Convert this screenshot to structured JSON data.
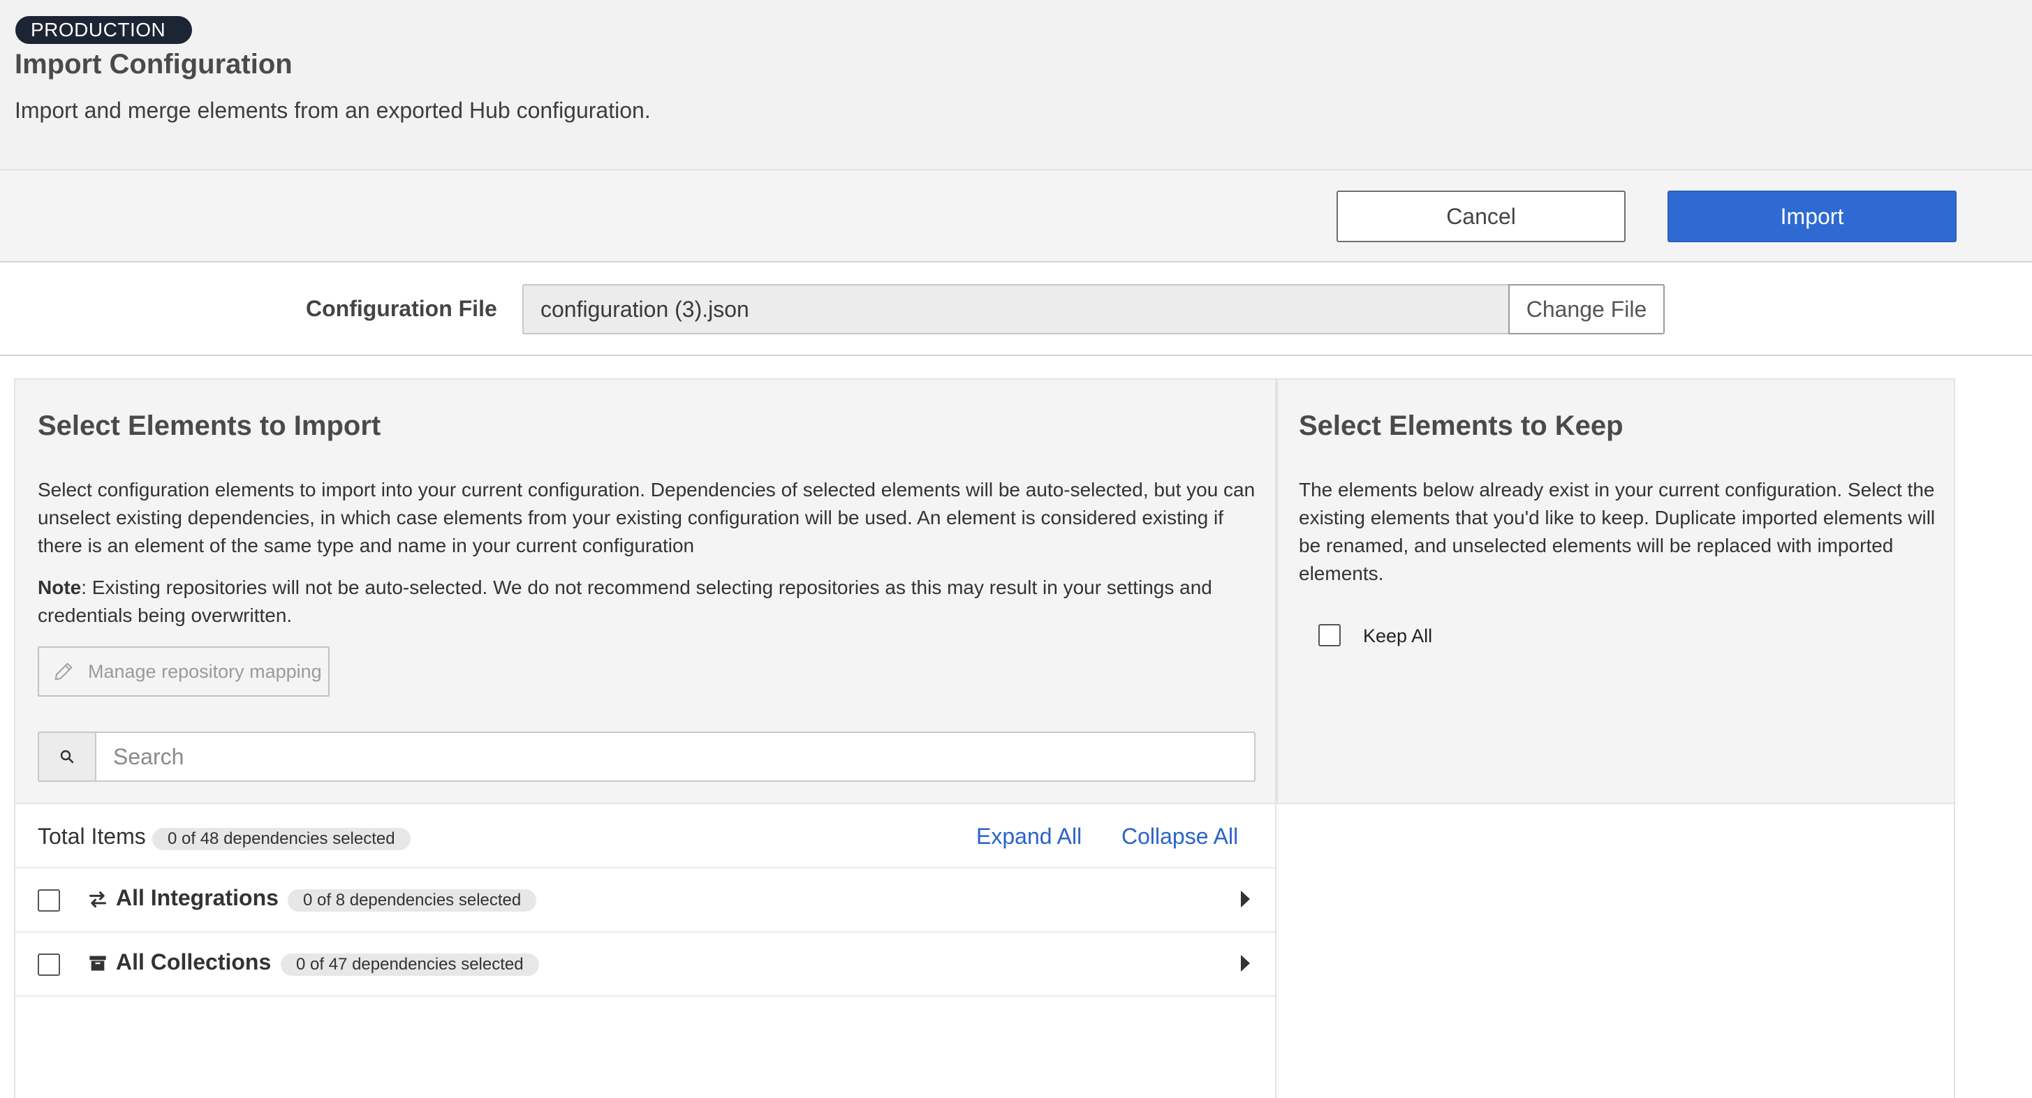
{
  "header": {
    "environment_badge": "PRODUCTION",
    "title": "Import Configuration",
    "subtitle": "Import and merge elements from an exported Hub configuration."
  },
  "actions": {
    "cancel_label": "Cancel",
    "import_label": "Import"
  },
  "config_file": {
    "label": "Configuration File",
    "value": "configuration (3).json",
    "change_label": "Change File"
  },
  "import_panel": {
    "title": "Select Elements to Import",
    "description": "Select configuration elements to import into your current configuration. Dependencies of selected elements will be auto-selected, but you can unselect existing dependencies, in which case elements from your existing configuration will be used. An element is considered existing if there is an element of the same type and name in your current configuration",
    "note_label": "Note",
    "note_text": ": Existing repositories will not be auto-selected. We do not recommend selecting repositories as this may result in your settings and credentials being overwritten.",
    "manage_mapping_label": "Manage repository mapping",
    "search_placeholder": "Search",
    "total_items_label": "Total Items",
    "total_items_badge": "0 of 48 dependencies selected",
    "expand_all_label": "Expand All",
    "collapse_all_label": "Collapse All",
    "items": [
      {
        "label": "All Integrations",
        "badge": "0 of 8 dependencies selected",
        "icon": "arrows-exchange-icon",
        "checked": false
      },
      {
        "label": "All Collections",
        "badge": "0 of 47 dependencies selected",
        "icon": "archive-box-icon",
        "checked": false
      }
    ]
  },
  "keep_panel": {
    "title": "Select Elements to Keep",
    "description": "The elements below already exist in your current configuration. Select the existing elements that you'd like to keep. Duplicate imported elements will be renamed, and unselected elements will be replaced with imported elements.",
    "keep_all_label": "Keep All",
    "keep_all_checked": false
  },
  "colors": {
    "primary": "#2f6ad3",
    "link": "#2a63c9",
    "badge_bg": "#1d2433",
    "panel_bg": "#f4f4f4"
  }
}
